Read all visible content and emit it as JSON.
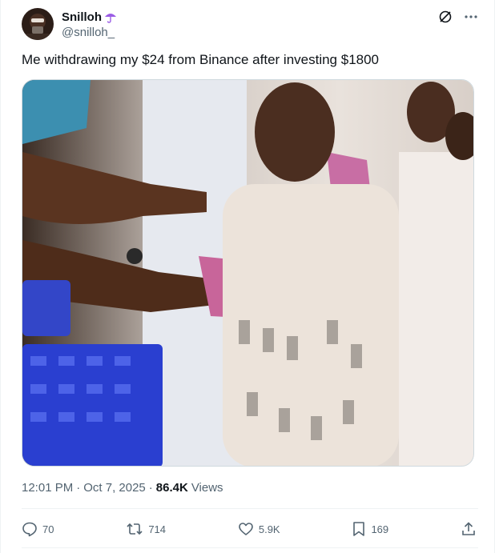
{
  "author": {
    "display_name": "Snilloh",
    "handle": "@snilloh_"
  },
  "tweet": {
    "text": "Me withdrawing my $24 from Binance after investing $1800",
    "time": "12:01 PM",
    "separator": "·",
    "date": "Oct 7, 2025",
    "views_count": "86.4K",
    "views_label": "Views"
  },
  "actions": {
    "reply_count": "70",
    "retweet_count": "714",
    "like_count": "5.9K",
    "bookmark_count": "169"
  },
  "icons": {
    "header": [
      "umbrella-icon",
      "grok-icon",
      "more-icon"
    ],
    "actions": [
      "reply-icon",
      "retweet-icon",
      "like-icon",
      "bookmark-icon",
      "share-icon"
    ]
  },
  "colors": {
    "text_primary": "#0f1419",
    "text_secondary": "#536471",
    "umbrella": "#9b5de5",
    "border": "#cfd9de"
  }
}
